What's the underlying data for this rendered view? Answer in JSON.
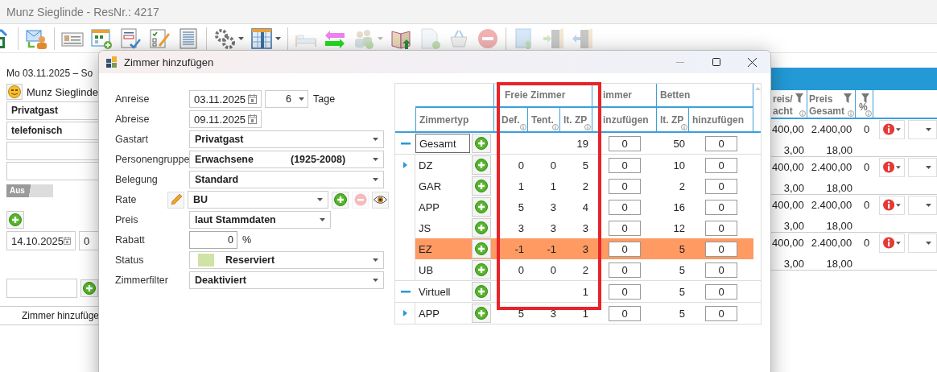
{
  "window": {
    "title": "Munz Sieglinde - ResNr.: 4217"
  },
  "toolbar": [
    {
      "kind": "export",
      "disabled": false,
      "dropdown": false
    },
    {
      "kind": "separator"
    },
    {
      "kind": "mail-person",
      "disabled": false,
      "dropdown": false
    },
    {
      "kind": "separator"
    },
    {
      "kind": "card",
      "disabled": false,
      "dropdown": false
    },
    {
      "kind": "calendar-add",
      "disabled": false,
      "dropdown": false
    },
    {
      "kind": "document-check",
      "disabled": false,
      "dropdown": false
    },
    {
      "kind": "checklist-edit",
      "disabled": false,
      "dropdown": false
    },
    {
      "kind": "list",
      "disabled": false,
      "dropdown": false
    },
    {
      "kind": "separator"
    },
    {
      "kind": "gears",
      "disabled": false,
      "dropdown": true
    },
    {
      "kind": "table",
      "disabled": false,
      "dropdown": true
    },
    {
      "kind": "separator"
    },
    {
      "kind": "bed",
      "disabled": true,
      "dropdown": false
    },
    {
      "kind": "swap",
      "disabled": false,
      "dropdown": false
    },
    {
      "kind": "people-add",
      "disabled": true,
      "dropdown": true
    },
    {
      "kind": "book",
      "disabled": false,
      "dropdown": false
    },
    {
      "kind": "page-add",
      "disabled": true,
      "dropdown": false
    },
    {
      "kind": "basket",
      "disabled": true,
      "dropdown": false
    },
    {
      "kind": "minus",
      "disabled": true,
      "dropdown": false
    },
    {
      "kind": "separator"
    },
    {
      "kind": "book-up",
      "disabled": true,
      "dropdown": false
    },
    {
      "kind": "door-in",
      "disabled": true,
      "dropdown": false
    },
    {
      "kind": "door-out",
      "disabled": true,
      "dropdown": false
    }
  ],
  "reservation_panel": {
    "date_range": "Mo 03.11.2025 – So",
    "guest": "Munz Sieglinde",
    "guest_type": "Privatgast",
    "booking_channel": "telefonisch",
    "toggle": {
      "label": "Aus",
      "on": false
    },
    "date": "14.10.2025",
    "count": "0",
    "tab": "Zimmer hinzufüge"
  },
  "price_table": {
    "columns": [
      {
        "lines": [
          "reis/",
          "acht"
        ]
      },
      {
        "lines": [
          "Preis",
          "Gesamt"
        ]
      },
      {
        "lines": [
          "%"
        ]
      }
    ],
    "rows": [
      {
        "per_night": "400,00",
        "total": "2.400,00",
        "discount": "0",
        "per_night_2": "3,00",
        "total_2": "18,00"
      },
      {
        "per_night": "400,00",
        "total": "2.400,00",
        "discount": "0",
        "per_night_2": "3,00",
        "total_2": "18,00"
      },
      {
        "per_night": "400,00",
        "total": "2.400,00",
        "discount": "0",
        "per_night_2": "3,00",
        "total_2": "18,00"
      },
      {
        "per_night": "400,00",
        "total": "2.400,00",
        "discount": "0",
        "per_night_2": "3,00",
        "total_2": "18,00"
      }
    ]
  },
  "dialog": {
    "title": "Zimmer hinzufügen",
    "form": [
      {
        "kind": "date_days",
        "label": "Anreise",
        "value": "03.11.2025",
        "days": "6",
        "days_unit": "Tage"
      },
      {
        "kind": "date",
        "label": "Abreise",
        "value": "09.11.2025"
      },
      {
        "kind": "select",
        "label": "Gastart",
        "value": "Privatgast"
      },
      {
        "kind": "select",
        "label": "Personengruppe",
        "value": "Erwachsene",
        "extra": "(1925-2008)"
      },
      {
        "kind": "select",
        "label": "Belegung",
        "value": "Standard"
      },
      {
        "kind": "rate",
        "label": "Rate",
        "value": "BU",
        "remove_disabled": true
      },
      {
        "kind": "select_short",
        "label": "Preis",
        "value": "laut Stammdaten"
      },
      {
        "kind": "percent",
        "label": "Rabatt",
        "value": "0",
        "unit": "%"
      },
      {
        "kind": "status",
        "label": "Status",
        "value": "Reserviert",
        "color": "#cfe3a6"
      },
      {
        "kind": "select",
        "label": "Zimmerfilter",
        "value": "Deaktiviert"
      }
    ],
    "grid": {
      "groups": [
        {
          "label": "Freie Zimmer"
        },
        {
          "label": "immer"
        },
        {
          "label": "Betten"
        }
      ],
      "columns": [
        {
          "label": "Zimmertyp",
          "info": false
        },
        {
          "label": "Def.",
          "info": true
        },
        {
          "label": "Tent.",
          "info": true
        },
        {
          "label": "lt. ZP",
          "info": true
        },
        {
          "label": "inzufügen",
          "info": false
        },
        {
          "label": "lt. ZP",
          "info": true
        },
        {
          "label": "hinzufügen",
          "info": false
        }
      ],
      "rows": [
        {
          "name": "Gesamt",
          "expanded": true,
          "focused": true,
          "ltzp": "19",
          "rooms_add": "0",
          "beds": "50",
          "beds_add": "0",
          "children": [
            {
              "name": "DZ",
              "expandable": true,
              "highlighted": false,
              "def": "0",
              "tent": "0",
              "ltzp": "5",
              "rooms_add": "0",
              "beds": "10",
              "beds_add": "0"
            },
            {
              "name": "GAR",
              "expandable": false,
              "highlighted": false,
              "def": "1",
              "tent": "1",
              "ltzp": "2",
              "rooms_add": "0",
              "beds": "2",
              "beds_add": "0"
            },
            {
              "name": "APP",
              "expandable": false,
              "highlighted": false,
              "def": "5",
              "tent": "3",
              "ltzp": "4",
              "rooms_add": "0",
              "beds": "16",
              "beds_add": "0"
            },
            {
              "name": "JS",
              "expandable": false,
              "highlighted": false,
              "def": "3",
              "tent": "3",
              "ltzp": "3",
              "rooms_add": "0",
              "beds": "12",
              "beds_add": "0"
            },
            {
              "name": "EZ",
              "expandable": false,
              "highlighted": true,
              "def": "-1",
              "tent": "-1",
              "ltzp": "3",
              "rooms_add": "0",
              "beds": "5",
              "beds_add": "0"
            },
            {
              "name": "UB",
              "expandable": false,
              "highlighted": false,
              "def": "0",
              "tent": "0",
              "ltzp": "2",
              "rooms_add": "0",
              "beds": "5",
              "beds_add": "0"
            }
          ]
        },
        {
          "name": "Virtuell",
          "expanded": true,
          "focused": false,
          "ltzp": "1",
          "rooms_add": "0",
          "beds": "5",
          "beds_add": "0",
          "children": [
            {
              "name": "APP",
              "expandable": true,
              "highlighted": false,
              "def": "5",
              "tent": "3",
              "ltzp": "1",
              "rooms_add": "0",
              "beds": "5",
              "beds_add": "0"
            }
          ]
        }
      ]
    }
  }
}
